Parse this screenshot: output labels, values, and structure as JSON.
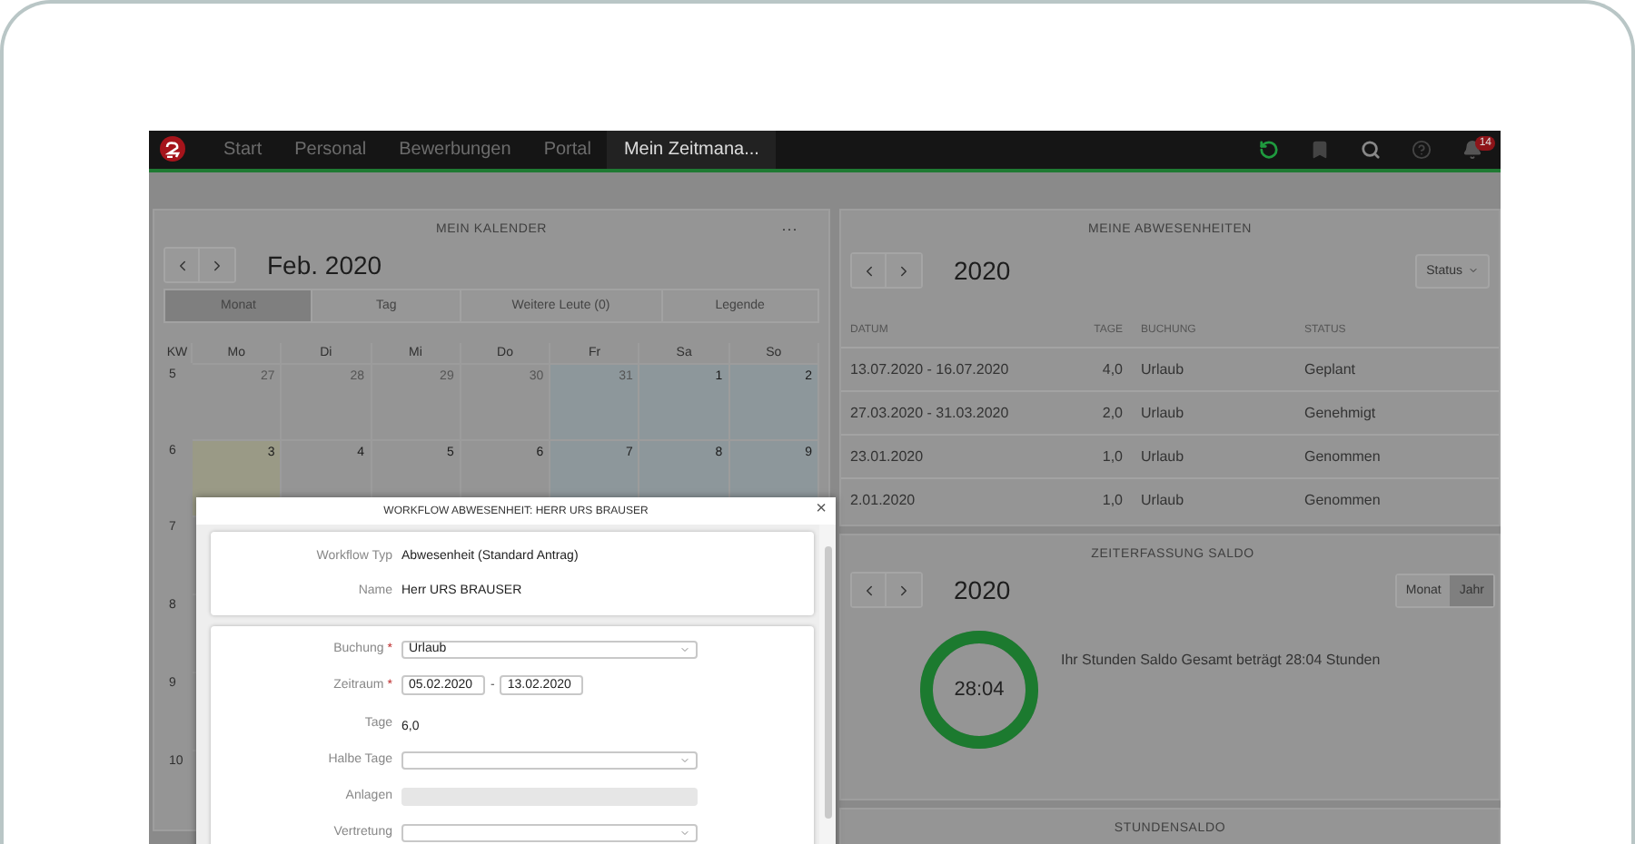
{
  "nav": {
    "items": [
      {
        "label": "Start",
        "selected": false
      },
      {
        "label": "Personal",
        "selected": false
      },
      {
        "label": "Bewerbungen",
        "selected": false
      },
      {
        "label": "Portal",
        "selected": false
      },
      {
        "label": "Mein Zeitmana...",
        "selected": true
      }
    ],
    "notification_count": "14"
  },
  "calendar": {
    "title": "MEIN KALENDER",
    "menu": "···",
    "month": "Feb. 2020",
    "tabs": [
      {
        "label": "Monat",
        "selected": true
      },
      {
        "label": "Tag",
        "selected": false
      },
      {
        "label": "Weitere Leute (0)",
        "selected": false
      },
      {
        "label": "Legende",
        "selected": false
      }
    ],
    "weekdays": [
      "KW",
      "Mo",
      "Di",
      "Mi",
      "Do",
      "Fr",
      "Sa",
      "So"
    ],
    "weeks": [
      {
        "kw": "5",
        "days": [
          {
            "day": "27",
            "muted": true
          },
          {
            "day": "28",
            "muted": true
          },
          {
            "day": "29",
            "muted": true
          },
          {
            "day": "30",
            "muted": true
          },
          {
            "day": "31",
            "muted": true,
            "color": "#8d979b"
          },
          {
            "day": "1",
            "muted": false,
            "color": "#8d979b"
          },
          {
            "day": "2",
            "muted": false,
            "color": "#8d979b"
          }
        ]
      },
      {
        "kw": "6",
        "days": [
          {
            "day": "3",
            "muted": false,
            "color": "#9a9a86"
          },
          {
            "day": "4",
            "muted": false
          },
          {
            "day": "5",
            "muted": false
          },
          {
            "day": "6",
            "muted": false
          },
          {
            "day": "7",
            "muted": false,
            "color": "#8d979b"
          },
          {
            "day": "8",
            "muted": false,
            "color": "#8d979b"
          },
          {
            "day": "9",
            "muted": false,
            "color": "#8d979b"
          }
        ]
      },
      {
        "kw": "7"
      },
      {
        "kw": "8"
      },
      {
        "kw": "9"
      },
      {
        "kw": "10"
      }
    ]
  },
  "absences": {
    "title": "MEINE ABWESENHEITEN",
    "year": "2020",
    "filter": "Status",
    "columns": [
      "DATUM",
      "TAGE",
      "BUCHUNG",
      "STATUS"
    ],
    "rows": [
      [
        "13.07.2020 - 16.07.2020",
        "4,0",
        "Urlaub",
        "Geplant"
      ],
      [
        "27.03.2020 - 31.03.2020",
        "2,0",
        "Urlaub",
        "Genehmigt"
      ],
      [
        "23.01.2020",
        "1,0",
        "Urlaub",
        "Genommen"
      ],
      [
        "2.01.2020",
        "1,0",
        "Urlaub",
        "Genommen"
      ]
    ]
  },
  "saldo": {
    "title": "ZEITERFASSUNG SALDO",
    "year": "2020",
    "toggle": [
      {
        "label": "Monat",
        "selected": false
      },
      {
        "label": "Jahr",
        "selected": true
      }
    ],
    "ring_value": "28:04",
    "level": 1,
    "message": "Ihr Stunden Saldo Gesamt beträgt 28:04 Stunden"
  },
  "stundensaldo": {
    "title": "STUNDENSALDO"
  },
  "dialog": {
    "title": "WORKFLOW ABWESENHEIT: HERR URS BRAUSER",
    "close": "×",
    "info": [
      {
        "label": "Workflow Typ",
        "value": "Abwesenheit (Standard Antrag)"
      },
      {
        "label": "Name",
        "value": "Herr URS BRAUSER"
      }
    ],
    "fields": [
      {
        "kind": "select",
        "label": "Buchung",
        "required_mark": "*",
        "value": "Urlaub",
        "disabled": false
      },
      {
        "kind": "range",
        "label": "Zeitraum",
        "required_mark": "*",
        "from": "05.02.2020",
        "separator": "-",
        "to": "13.02.2020"
      },
      {
        "kind": "text",
        "label": "Tage",
        "value": "6,0"
      },
      {
        "kind": "select",
        "label": "Halbe Tage",
        "disabled": false
      },
      {
        "kind": "select",
        "label": "Anlagen",
        "disabled": true
      },
      {
        "kind": "select",
        "label": "Vertretung",
        "disabled": false
      }
    ]
  }
}
